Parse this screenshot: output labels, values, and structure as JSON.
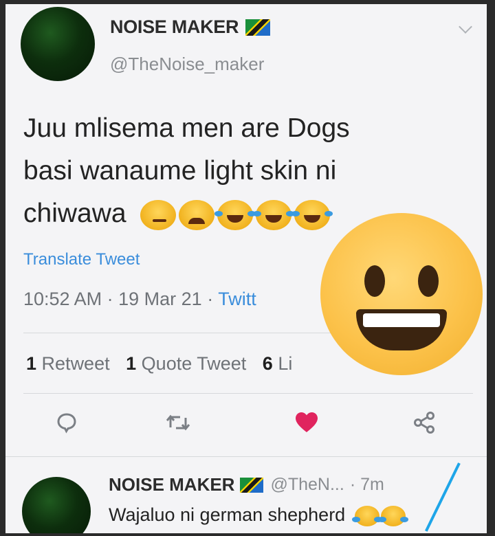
{
  "tweet": {
    "author_name": "NOISE MAKER",
    "author_handle": "@TheNoise_maker",
    "text_line1": "Juu mlisema men are Dogs",
    "text_line2": "basi wanaume light skin ni",
    "text_line3": "chiwawa",
    "emojis": [
      "smirking-face",
      "tired-face",
      "face-with-tears-of-joy",
      "face-with-tears-of-joy",
      "face-with-tears-of-joy"
    ],
    "translate_label": "Translate Tweet",
    "time": "10:52 AM",
    "date": "19 Mar 21",
    "client": "Twitt",
    "stats": {
      "retweets_count": "1",
      "retweets_label": "Retweet",
      "quote_count": "1",
      "quote_label": "Quote Tweet",
      "likes_count": "6",
      "likes_label": "Li"
    }
  },
  "reply": {
    "author_name": "NOISE MAKER",
    "author_handle": "@TheN...",
    "time": "7m",
    "text": "Wajaluo  ni german shepherd",
    "emojis": [
      "face-with-tears-of-joy",
      "face-with-tears-of-joy"
    ]
  },
  "overlay": {
    "icon": "grinning-face-emoji"
  },
  "colors": {
    "link": "#3a8ddb",
    "like": "#e0245e",
    "muted": "#6e7277"
  }
}
